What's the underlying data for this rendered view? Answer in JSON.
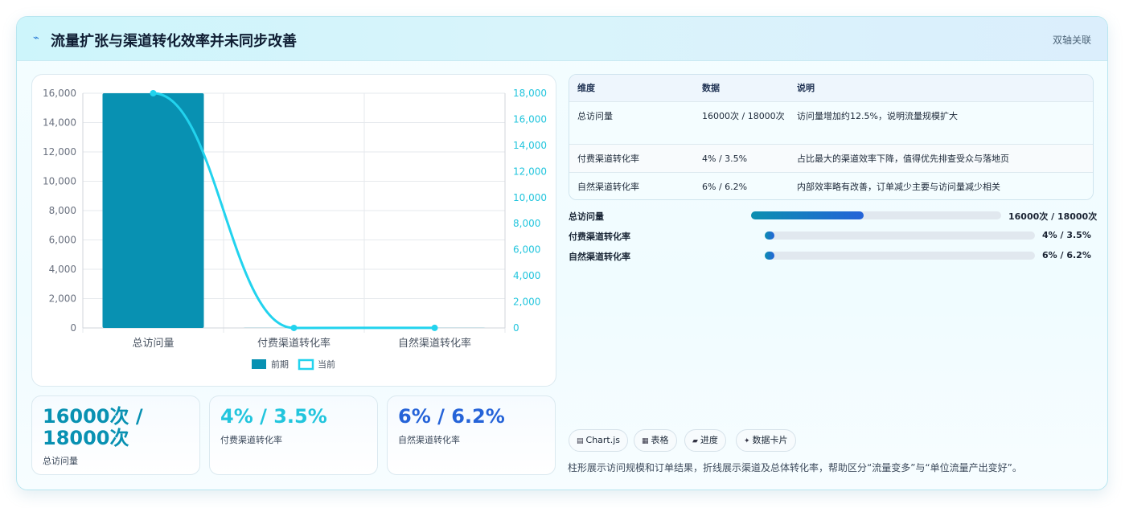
{
  "header": {
    "icon": "pulse-icon",
    "title": "流量扩张与渠道转化效率并未同步改善",
    "badge": "双轴关联"
  },
  "chart_data": {
    "type": "bar",
    "categories": [
      "总访问量",
      "付费渠道转化率",
      "自然渠道转化率"
    ],
    "series": [
      {
        "name": "前期",
        "type": "bar",
        "axis": "left",
        "values": [
          16000,
          4,
          6
        ],
        "color": "#0891b2"
      },
      {
        "name": "当前",
        "type": "line",
        "axis": "right",
        "values": [
          18000,
          3.5,
          6.2
        ],
        "color": "#22d3ee"
      }
    ],
    "y_left": {
      "min": 0,
      "max": 16000,
      "ticks": [
        "16,000",
        "14,000",
        "12,000",
        "10,000",
        "8,000",
        "6,000",
        "4,000",
        "2,000",
        "0"
      ]
    },
    "y_right": {
      "min": 0,
      "max": 18000,
      "ticks": [
        "18,000",
        "16,000",
        "14,000",
        "12,000",
        "10,000",
        "8,000",
        "6,000",
        "4,000",
        "2,000",
        "0"
      ]
    },
    "grid": true,
    "legend_position": "bottom"
  },
  "stats": [
    {
      "value": "16000次 / 18000次",
      "label": "总访问量",
      "color": "#0891b2"
    },
    {
      "value": "4% / 3.5%",
      "label": "付费渠道转化率",
      "color": "#22c5dd"
    },
    {
      "value": "6% / 6.2%",
      "label": "自然渠道转化率",
      "color": "#2563d8"
    }
  ],
  "table": {
    "headers": [
      "维度",
      "数据",
      "说明"
    ],
    "rows": [
      [
        "总访问量",
        "16000次 / 18000次",
        "访问量增加约12.5%，说明流量规模扩大"
      ],
      [
        "付费渠道转化率",
        "4% / 3.5%",
        "占比最大的渠道效率下降，值得优先排查受众与落地页"
      ],
      [
        "自然渠道转化率",
        "6% / 6.2%",
        "内部效率略有改善，订单减少主要与访问量减少相关"
      ]
    ]
  },
  "progress": [
    {
      "label": "总访问量",
      "value": "16000次 / 18000次",
      "fraction": 0.45
    },
    {
      "label": "付费渠道转化率",
      "value": "4% / 3.5%",
      "fraction": 0.035
    },
    {
      "label": "自然渠道转化率",
      "value": "6% / 6.2%",
      "fraction": 0.035
    }
  ],
  "tags": [
    {
      "icon": "chart-icon",
      "glyph": "▤",
      "label": "Chart.js"
    },
    {
      "icon": "table-icon",
      "glyph": "▦",
      "label": "表格"
    },
    {
      "icon": "progress-icon",
      "glyph": "▰",
      "label": "进度"
    },
    {
      "icon": "card-icon",
      "glyph": "✦",
      "label": "数据卡片"
    }
  ],
  "footnote": "柱形展示访问规模和订单结果，折线展示渠道及总体转化率，帮助区分“流量变多”与“单位流量产出变好”。"
}
